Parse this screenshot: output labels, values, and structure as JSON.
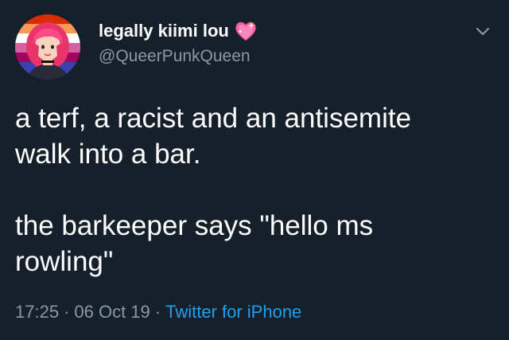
{
  "tweet": {
    "display_name": "legally kiimi lou",
    "name_emoji_icon": "sparkling-heart-icon",
    "handle": "@QueerPunkQueen",
    "text": "a terf, a racist and an antisemite\nwalk into a bar.\n\nthe barkeeper says \"hello ms\nrowling\"",
    "time": "17:25",
    "separator": "·",
    "date": "06 Oct 19",
    "source": "Twitter for iPhone",
    "menu_icon": "chevron-down-icon"
  },
  "colors": {
    "background": "#15202b",
    "text": "#ffffff",
    "secondary": "#8899a6",
    "link": "#1da1f2",
    "heart": "#ff5fa2"
  }
}
